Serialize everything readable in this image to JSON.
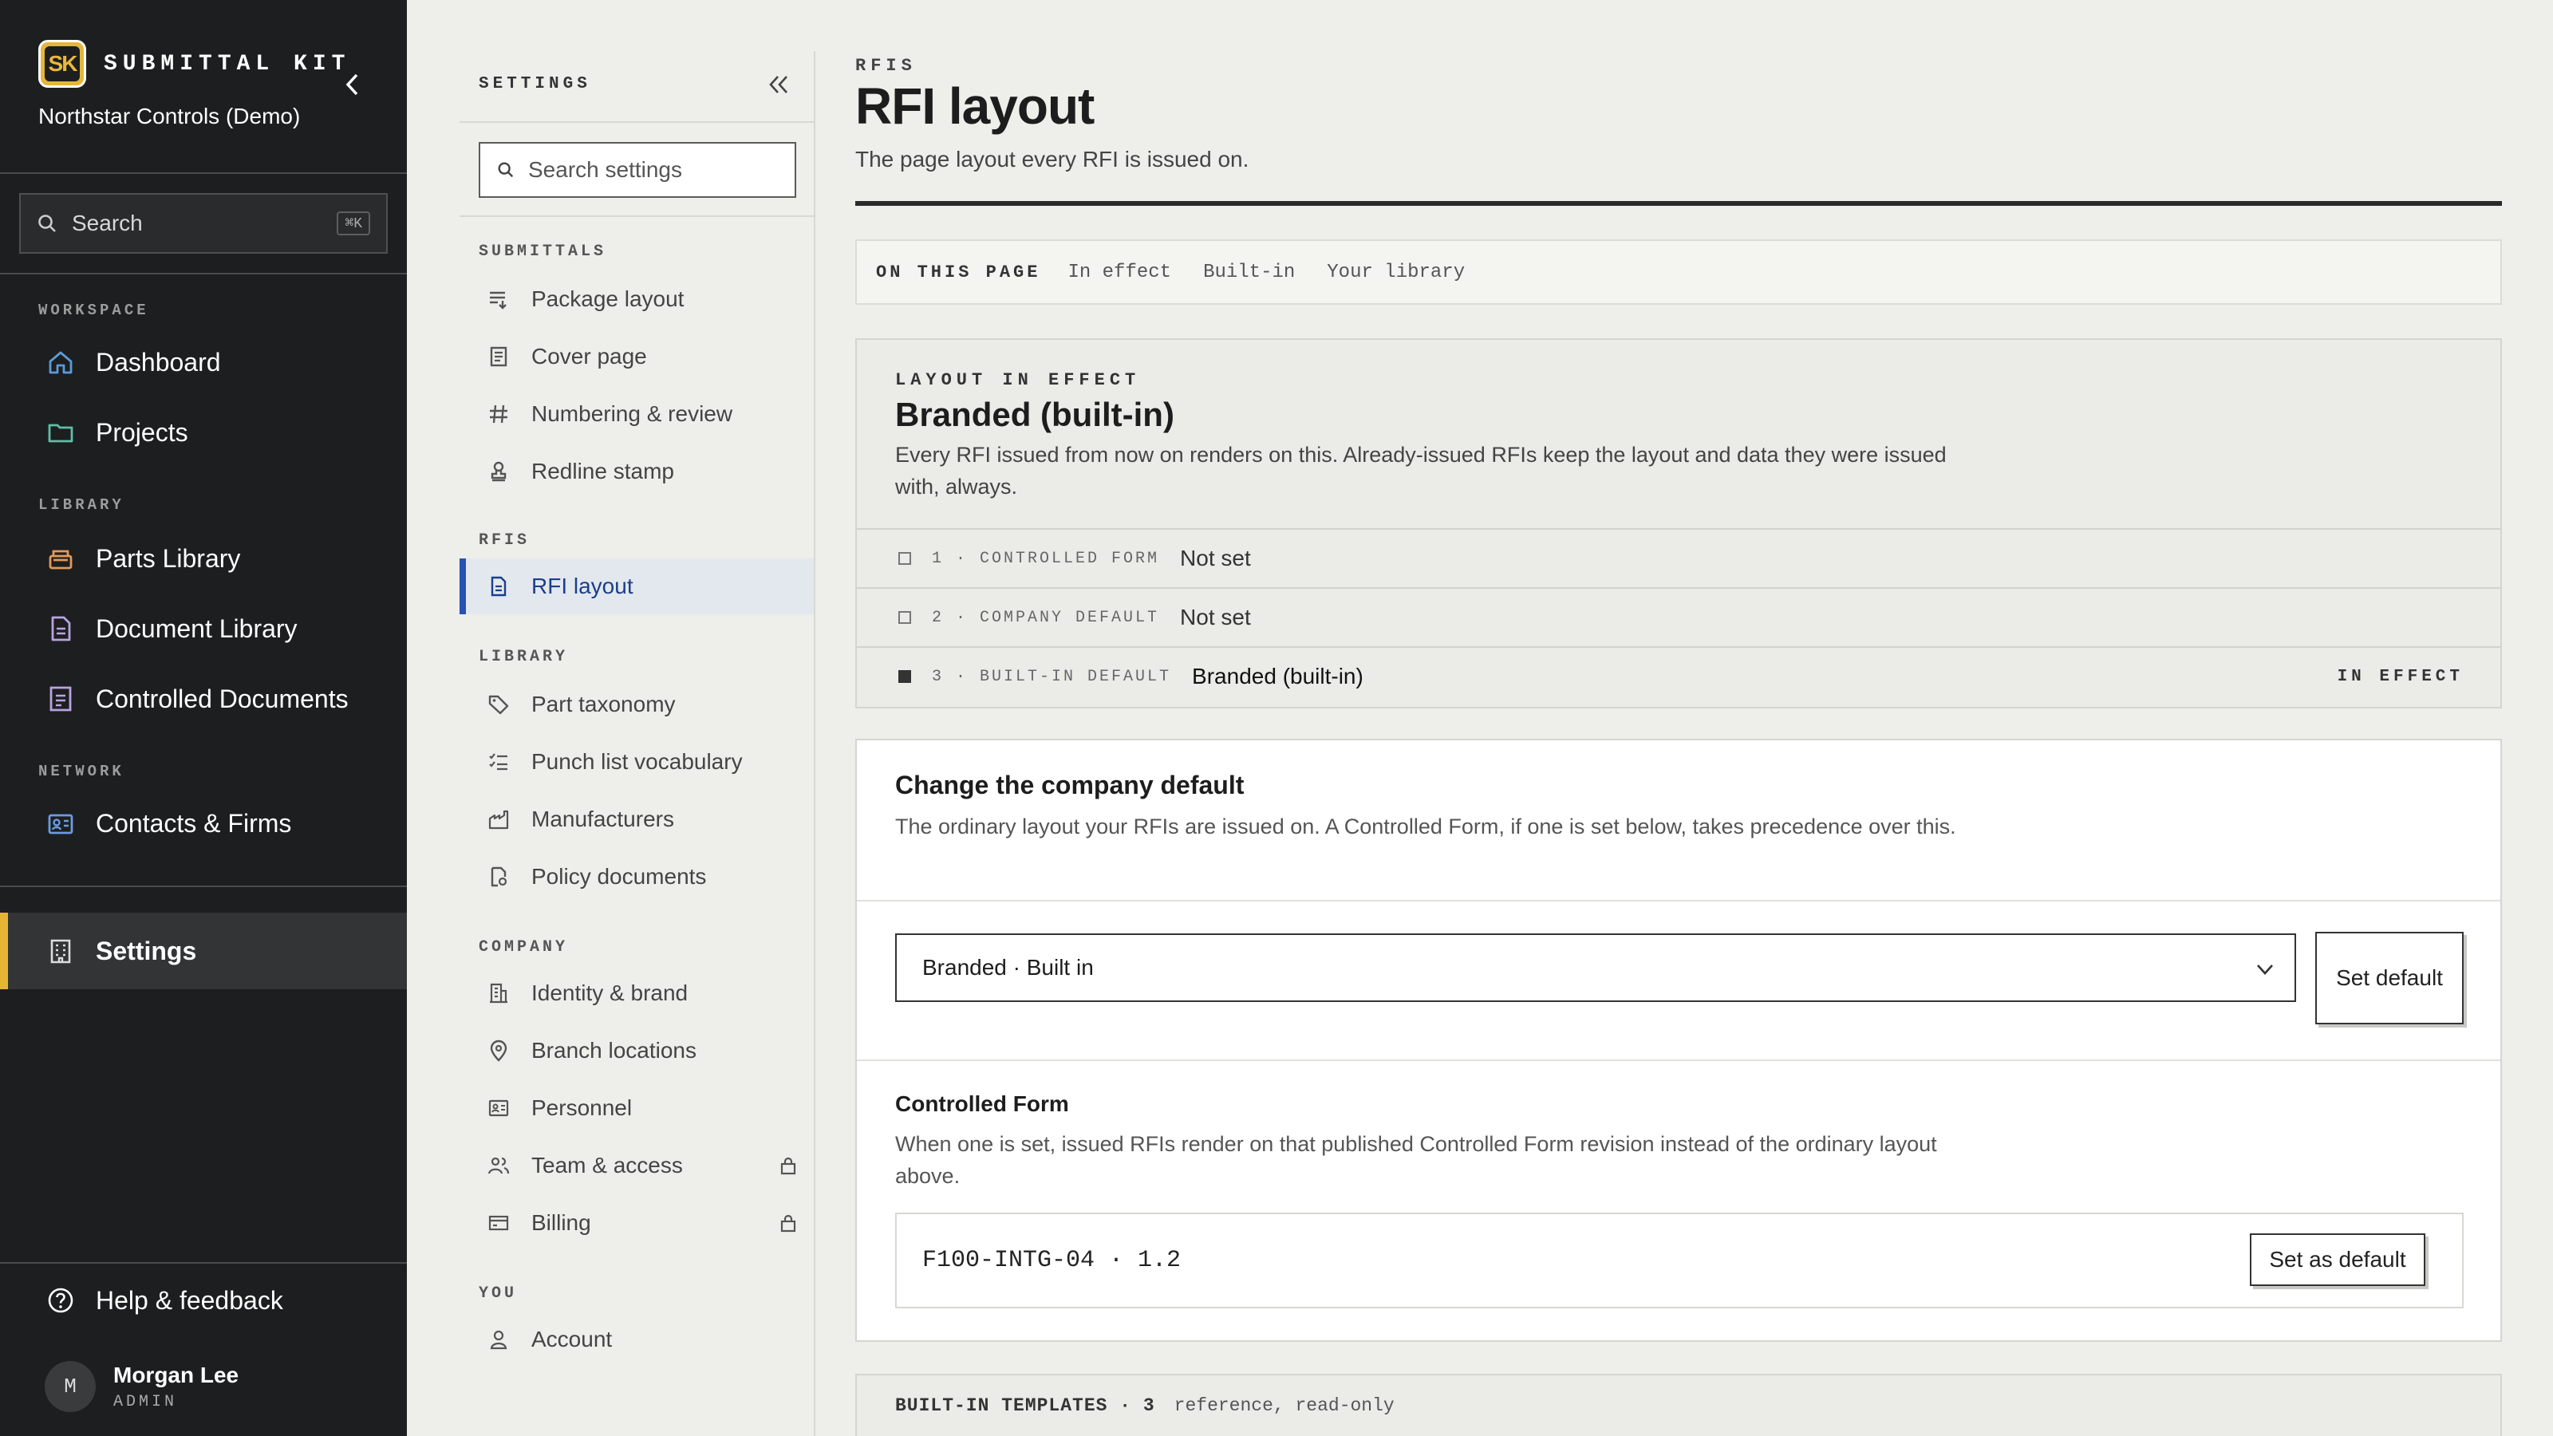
{
  "sidebar": {
    "brand_logo_text": "SK",
    "brand_name": "SUBMITTAL KIT",
    "org": "Northstar Controls (Demo)",
    "search": {
      "label": "Search",
      "shortcut": "⌘K"
    },
    "sections": {
      "workspace": "WORKSPACE",
      "library": "LIBRARY",
      "network": "NETWORK"
    },
    "items": {
      "dashboard": "Dashboard",
      "projects": "Projects",
      "parts_library": "Parts Library",
      "document_library": "Document Library",
      "controlled_documents": "Controlled Documents",
      "contacts": "Contacts & Firms",
      "settings": "Settings"
    },
    "help": "Help & feedback",
    "user": {
      "initial": "M",
      "name": "Morgan Lee",
      "role": "ADMIN"
    },
    "accent_color": "#e6b435"
  },
  "settings_nav": {
    "title": "SETTINGS",
    "search_placeholder": "Search settings",
    "sections": {
      "submittals": "SUBMITTALS",
      "rfis": "RFIS",
      "library": "LIBRARY",
      "company": "COMPANY",
      "you": "YOU"
    },
    "items": {
      "package_layout": "Package layout",
      "cover_page": "Cover page",
      "numbering": "Numbering & review",
      "redline": "Redline stamp",
      "rfi_layout": "RFI layout",
      "part_taxonomy": "Part taxonomy",
      "punch_list": "Punch list vocabulary",
      "manufacturers": "Manufacturers",
      "policy_docs": "Policy documents",
      "identity": "Identity & brand",
      "branches": "Branch locations",
      "personnel": "Personnel",
      "team": "Team & access",
      "billing": "Billing",
      "account": "Account"
    },
    "active_color": "#2552b3"
  },
  "main": {
    "eyebrow": "RFIS",
    "title": "RFI layout",
    "subtitle": "The page layout every RFI is issued on.",
    "on_this_page": {
      "label": "ON THIS PAGE",
      "links": {
        "in_effect": "In effect",
        "built_in": "Built-in",
        "your_library": "Your library"
      }
    },
    "in_effect": {
      "heading": "LAYOUT IN EFFECT",
      "title": "Branded (built-in)",
      "description": "Every RFI issued from now on renders on this. Already-issued RFIs keep the layout and data they were issued with, always.",
      "rows": [
        {
          "num": "1 · CONTROLLED FORM",
          "value": "Not set"
        },
        {
          "num": "2 · COMPANY DEFAULT",
          "value": "Not set"
        },
        {
          "num": "3 · BUILT-IN DEFAULT",
          "value": "Branded (built-in)",
          "tag": "IN EFFECT"
        }
      ]
    },
    "change_default": {
      "title": "Change the company default",
      "description": "The ordinary layout your RFIs are issued on. A Controlled Form, if one is set below, takes precedence over this.",
      "select_value": "Branded · Built in",
      "set_default_button": "Set default",
      "controlled_form": {
        "title": "Controlled Form",
        "description": "When one is set, issued RFIs render on that published Controlled Form revision instead of the ordinary layout above.",
        "code": "F100-INTG-04 · 1.2",
        "set_as_default_button": "Set as default"
      }
    },
    "builtin_bar": {
      "label": "BUILT-IN TEMPLATES · 3",
      "note": "reference, read-only"
    }
  }
}
